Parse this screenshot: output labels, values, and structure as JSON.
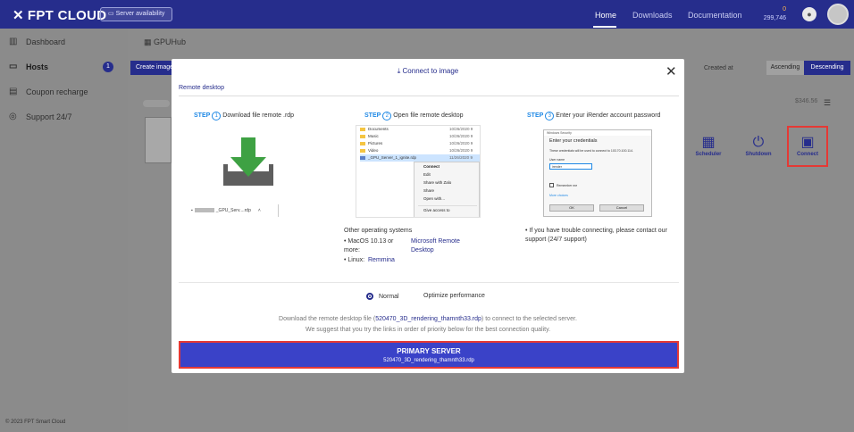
{
  "header": {
    "logo": "FPT CLOUD",
    "server_availability": "Server availability",
    "nav": [
      "Home",
      "Downloads",
      "Documentation"
    ],
    "balance_top": "0",
    "balance_sub": "299,746"
  },
  "sidebar": {
    "items": [
      {
        "label": "Dashboard",
        "icon": "chart-icon"
      },
      {
        "label": "Hosts",
        "icon": "monitor-icon"
      },
      {
        "label": "Coupon recharge",
        "icon": "coupon-icon"
      },
      {
        "label": "Support 24/7",
        "icon": "headset-icon"
      }
    ],
    "hosts_badge": "1",
    "footer": "© 2023 FPT Smart Cloud"
  },
  "main": {
    "title": "GPUHub",
    "create_button": "Create image",
    "created_at": "Created at",
    "ascending": "Ascending",
    "descending": "Descending",
    "totals": "$346.56",
    "actions": [
      "Scheduler",
      "Shutdown",
      "Connect"
    ]
  },
  "modal": {
    "title": "Connect to image",
    "tab": "Remote desktop",
    "step_word": "STEP",
    "steps": [
      {
        "num": "1",
        "label": "Download file remote .rdp"
      },
      {
        "num": "2",
        "label": "Open file remote desktop"
      },
      {
        "num": "3",
        "label": "Enter your iRender account password"
      }
    ],
    "download_file": "_GPU_Serv....rdp",
    "explorer": {
      "rows": [
        {
          "name": "Documents",
          "date": "10/26/2020 9"
        },
        {
          "name": "Music",
          "date": "10/26/2020 9"
        },
        {
          "name": "Pictures",
          "date": "10/26/2020 9"
        },
        {
          "name": "Video",
          "date": "10/26/2020 9"
        },
        {
          "name": "_GPU_Server_1_ignite.rdp",
          "date": "11/26/2020 9"
        }
      ],
      "menu": [
        "Connect",
        "Edit",
        "Share with Zalo",
        "Share",
        "Open with...",
        "Give access to"
      ]
    },
    "other_os": "Other operating systems",
    "macos": "MacOS 10.13 or more:",
    "macos_link": "Microsoft Remote Desktop",
    "linux": "Linux:",
    "linux_link": "Remmina",
    "cred": {
      "bar": "Windows Security",
      "heading": "Enter your credentials",
      "line1": "These credentials will be used to connect to 103.70.100.114.",
      "user_label": "User name",
      "field": "irender",
      "pwd_hint": "",
      "remember": "Remember me",
      "more": "More choices",
      "ok": "OK",
      "cancel": "Cancel"
    },
    "help": "If you have trouble connecting, please contact our support (24/7 support)",
    "mode_normal": "Normal",
    "mode_optimize": "Optimize performance",
    "desc1_pre": "Download the remote desktop file (",
    "desc1_file": "520470_3D_rendering_thamnth33.rdp",
    "desc1_post": ") to connect to the selected server.",
    "desc2": "We suggest that you try the links in order of priority below for the best connection quality.",
    "primary_label": "PRIMARY SERVER",
    "primary_file": "520470_3D_rendering_thamnth33.rdp"
  }
}
